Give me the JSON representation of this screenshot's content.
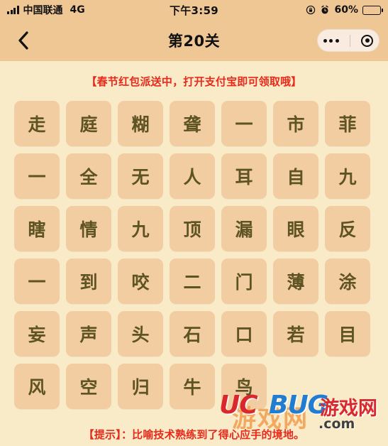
{
  "status_bar": {
    "signal_icon": "signal-bars-icon",
    "carrier": "中国联通",
    "network": "4G",
    "time": "下午3:59",
    "rotation_lock_icon": "rotation-lock-icon",
    "alarm_icon": "alarm-clock-icon",
    "battery_percent": "60%",
    "battery_level": 60,
    "battery_icon": "battery-icon"
  },
  "nav_bar": {
    "back_icon": "back-chevron-icon",
    "title": "第20关",
    "menu_icon": "ellipsis-icon",
    "close_icon": "target-circle-icon"
  },
  "banner": {
    "text": "【春节红包派送中，打开支付宝即可领取哦】",
    "color": "#E8291C"
  },
  "grid": {
    "columns": 7,
    "tile_color": "#F3CDA2",
    "tile_text_color": "#5D5323",
    "rows": [
      [
        "走",
        "庭",
        "糊",
        "聋",
        "一",
        "市",
        "菲"
      ],
      [
        "一",
        "全",
        "无",
        "人",
        "耳",
        "自",
        "九"
      ],
      [
        "瞎",
        "情",
        "九",
        "顶",
        "漏",
        "眼",
        "反"
      ],
      [
        "一",
        "到",
        "咬",
        "二",
        "门",
        "薄",
        "涂"
      ],
      [
        "妄",
        "声",
        "头",
        "石",
        "口",
        "若",
        "目"
      ],
      [
        "风",
        "空",
        "归",
        "牛",
        "鸟"
      ]
    ]
  },
  "hint": {
    "text": "【提示】：比喻技术熟练到了得心应手的境地。",
    "color": "#E8291C"
  },
  "watermark": {
    "uc": "UC",
    "bug": "BUG",
    "site": "游戏网",
    "ghost": "游戏网",
    "domain": ".com"
  },
  "theme": {
    "page_background": "#FAEBC8",
    "header_background": "#EFC795",
    "capsule_background": "#FAEBE0"
  }
}
